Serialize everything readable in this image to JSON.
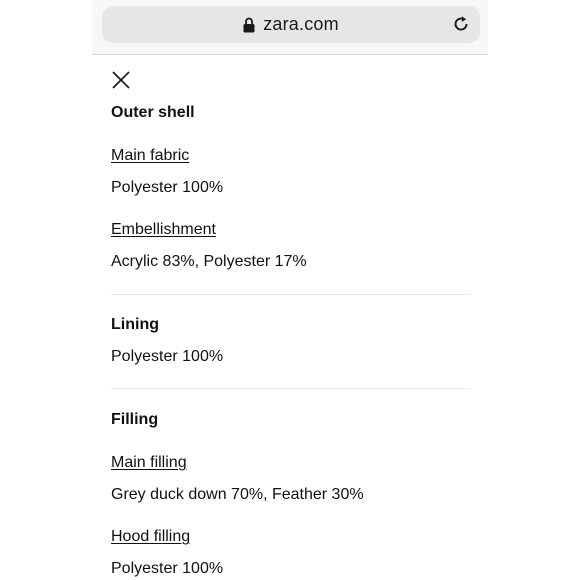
{
  "browser": {
    "url": "zara.com"
  },
  "composition": {
    "outer_shell": {
      "title": "Outer shell",
      "main_fabric_label": "Main fabric",
      "main_fabric_value": "Polyester 100%",
      "embellishment_label": "Embellishment",
      "embellishment_value": "Acrylic 83%, Polyester 17%"
    },
    "lining": {
      "title": "Lining",
      "value": "Polyester 100%"
    },
    "filling": {
      "title": "Filling",
      "main_filling_label": "Main filling",
      "main_filling_value": "Grey duck down 70%, Feather 30%",
      "hood_filling_label": "Hood filling",
      "hood_filling_value": "Polyester 100%"
    }
  }
}
